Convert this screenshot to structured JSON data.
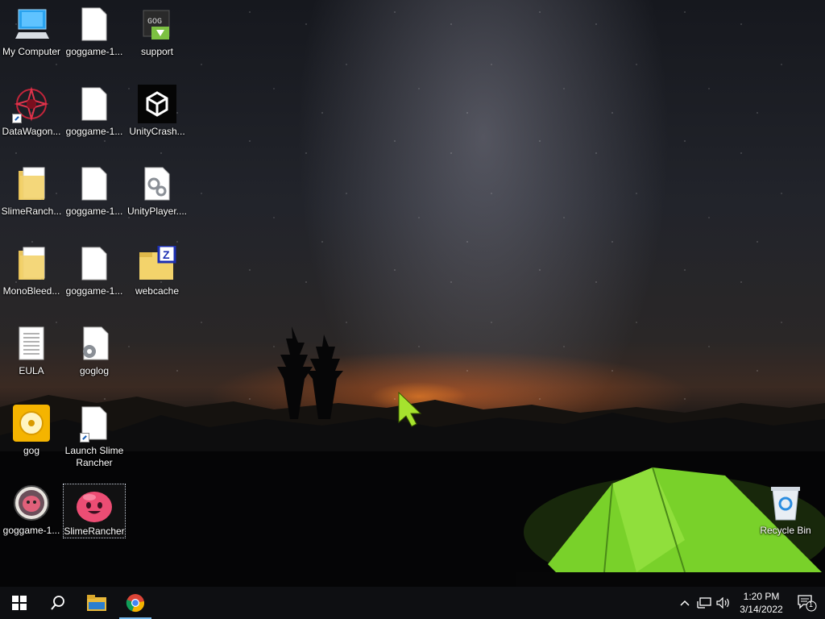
{
  "desktop": {
    "icons": [
      {
        "label": "My Computer"
      },
      {
        "label": "goggame-1..."
      },
      {
        "label": "support"
      },
      {
        "label": "DataWagon..."
      },
      {
        "label": "goggame-1..."
      },
      {
        "label": "UnityCrash..."
      },
      {
        "label": "SlimeRanch..."
      },
      {
        "label": "goggame-1..."
      },
      {
        "label": "UnityPlayer...."
      },
      {
        "label": "MonoBleed..."
      },
      {
        "label": "goggame-1..."
      },
      {
        "label": "webcache"
      },
      {
        "label": "EULA"
      },
      {
        "label": "goglog"
      },
      {
        "label": "gog"
      },
      {
        "label": "Launch Slime Rancher"
      },
      {
        "label": "goggame-1..."
      },
      {
        "label": "SlimeRancher"
      },
      {
        "label": "Recycle Bin"
      }
    ]
  },
  "taskbar": {
    "pinned": [
      {
        "name": "start",
        "icon": "windows-logo"
      },
      {
        "name": "search",
        "icon": "magnifier"
      },
      {
        "name": "file-explorer",
        "icon": "folder"
      },
      {
        "name": "chrome",
        "icon": "chrome-logo"
      }
    ],
    "clock": {
      "time": "1:20 PM",
      "date": "3/14/2022"
    },
    "notification_count": "1"
  },
  "colors": {
    "taskbar": "#0e0f12",
    "accent": "#76b9ed",
    "tent": "#7bd12a",
    "cursor": "#a6e22e"
  }
}
